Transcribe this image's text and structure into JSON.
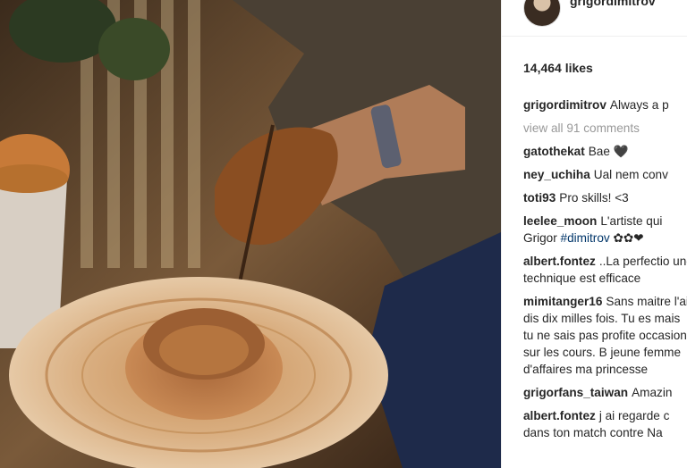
{
  "post": {
    "username": "grigordimitrov",
    "likes": "14,464 likes",
    "view_all": "view all 91 comments",
    "caption": {
      "user": "grigordimitrov",
      "text": "Always a p"
    },
    "comments": [
      {
        "user": "gatothekat",
        "text": "Bae 🖤"
      },
      {
        "user": "ney_uchiha",
        "text": "Ual nem conv"
      },
      {
        "user": "toti93",
        "text": "Pro skills! <3"
      },
      {
        "user": "leelee_moon",
        "text": "L'artiste qui",
        "line2_pre": "Grigor ",
        "hashtag": "#dimitrov",
        "line2_post": " ✿✿❤"
      },
      {
        "user": "albert.fontez",
        "text": "..La perfectio une technique est efficace"
      },
      {
        "user": "mimitanger16",
        "text": "Sans maitre l'ai dis dix milles fois. Tu es mais tu ne sais pas profite occasions sur les cours. B jeune femme d'affaires ma princesse"
      },
      {
        "user": "grigorfans_taiwan",
        "text": "Amazin"
      },
      {
        "user": "albert.fontez",
        "text": "j ai regarde c dans ton match contre Na"
      }
    ]
  },
  "colors": {
    "username": "#262626",
    "muted": "#999999",
    "hashtag": "#003569",
    "clay": "#b8753a"
  }
}
